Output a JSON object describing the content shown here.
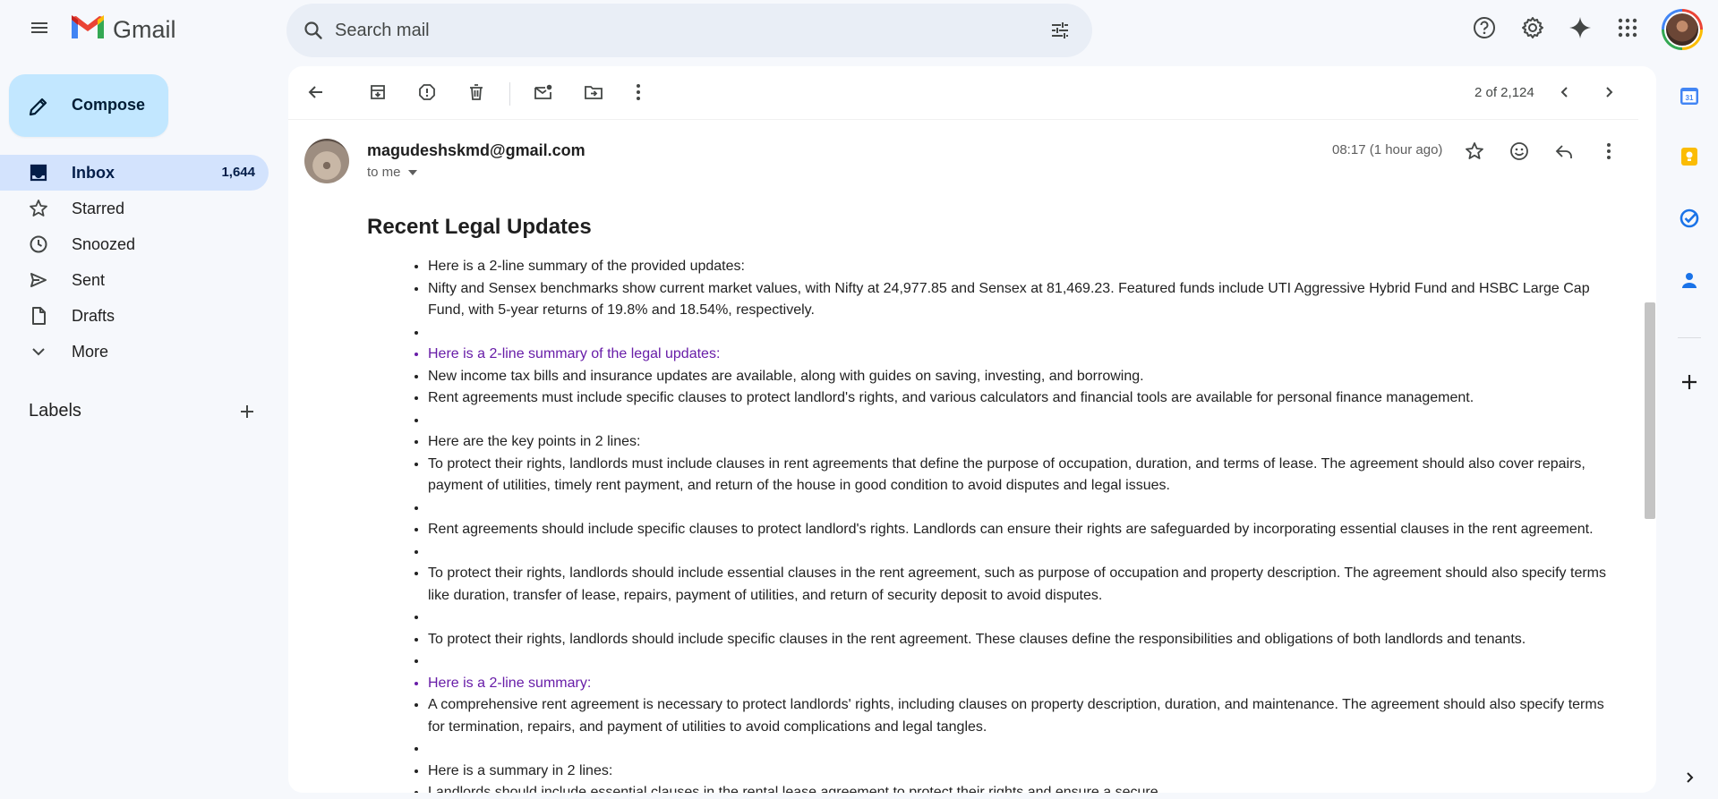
{
  "app": {
    "name": "Gmail",
    "colors": {
      "compose_bg": "#c2e7ff",
      "active_nav_bg": "#d3e3fd",
      "search_bg": "#e9eef6",
      "link_purple": "#681da8"
    }
  },
  "search": {
    "placeholder": "Search mail"
  },
  "compose": {
    "label": "Compose"
  },
  "nav": {
    "items": [
      {
        "label": "Inbox",
        "count": "1,644",
        "icon": "inbox-icon",
        "active": true
      },
      {
        "label": "Starred",
        "icon": "star-icon"
      },
      {
        "label": "Snoozed",
        "icon": "clock-icon"
      },
      {
        "label": "Sent",
        "icon": "send-icon"
      },
      {
        "label": "Drafts",
        "icon": "draft-icon"
      },
      {
        "label": "More",
        "icon": "chevron-down-icon"
      }
    ],
    "labels_header": "Labels"
  },
  "toolbar": {
    "pager": "2 of 2,124"
  },
  "message": {
    "sender": "magudeshskmd@gmail.com",
    "to": "to me",
    "time": "08:17 (1 hour ago)",
    "subject": "Recent Legal Updates",
    "items": [
      {
        "text": "Here is a 2-line summary of the provided updates:"
      },
      {
        "text": "Nifty and Sensex benchmarks show current market values, with Nifty at 24,977.85 and Sensex at 81,469.23. Featured funds include UTI Aggressive Hybrid Fund and HSBC Large Cap Fund, with 5-year returns of 19.8% and 18.54%, respectively."
      },
      {
        "text": ""
      },
      {
        "text": "Here is a 2-line summary of the legal updates:",
        "link": true
      },
      {
        "text": "New income tax bills and insurance updates are available, along with guides on saving, investing, and borrowing."
      },
      {
        "text": "Rent agreements must include specific clauses to protect landlord's rights, and various calculators and financial tools are available for personal finance management."
      },
      {
        "text": ""
      },
      {
        "text": "Here are the key points in 2 lines:"
      },
      {
        "text": "To protect their rights, landlords must include clauses in rent agreements that define the purpose of occupation, duration, and terms of lease. The agreement should also cover repairs, payment of utilities, timely rent payment, and return of the house in good condition to avoid disputes and legal issues."
      },
      {
        "text": ""
      },
      {
        "text": "Rent agreements should include specific clauses to protect landlord's rights. Landlords can ensure their rights are safeguarded by incorporating essential clauses in the rent agreement."
      },
      {
        "text": ""
      },
      {
        "text": "To protect their rights, landlords should include essential clauses in the rent agreement, such as purpose of occupation and property description. The agreement should also specify terms like duration, transfer of lease, repairs, payment of utilities, and return of security deposit to avoid disputes."
      },
      {
        "text": ""
      },
      {
        "text": "To protect their rights, landlords should include specific clauses in the rent agreement. These clauses define the responsibilities and obligations of both landlords and tenants."
      },
      {
        "text": ""
      },
      {
        "text": "Here is a 2-line summary:",
        "link": true
      },
      {
        "text": "A comprehensive rent agreement is necessary to protect landlords' rights, including clauses on property description, duration, and maintenance. The agreement should also specify terms for termination, repairs, and payment of utilities to avoid complications and legal tangles."
      },
      {
        "text": ""
      },
      {
        "text": "Here is a summary in 2 lines:"
      },
      {
        "text": "Landlords should include essential clauses in the rental lease agreement to protect their rights and ensure a secure ... "
      }
    ]
  }
}
